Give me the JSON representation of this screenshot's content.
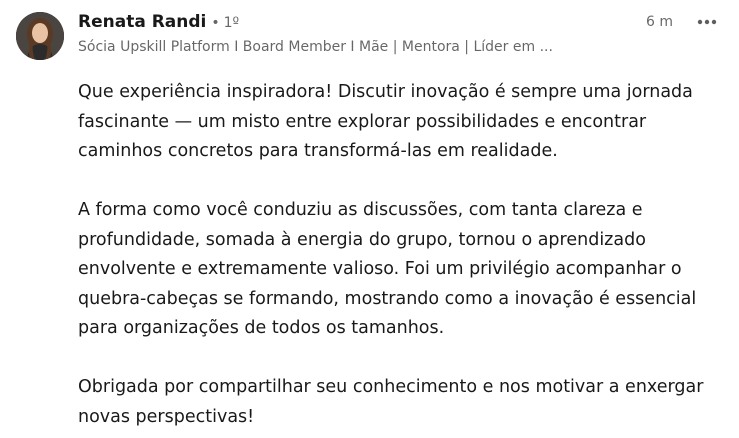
{
  "comment": {
    "author": {
      "name": "Renata Randi",
      "bullet": "•",
      "degree": "1º",
      "headline": "Sócia Upskill Platform I Board Member I Mãe | Mentora | Líder em ..."
    },
    "timestamp": "6 m",
    "more_icon": "more-horizontal-icon",
    "paragraphs": [
      "Que experiência inspiradora! Discutir inovação é sempre uma jornada fascinante — um misto entre explorar possibilidades e encontrar caminhos concretos para transformá-las em realidade.",
      "A forma como você conduziu as discussões, com tanta clareza e profundidade, somada à energia do grupo, tornou o aprendizado envolvente e extremamente valioso. Foi um privilégio acompanhar o quebra-cabeças se formando, mostrando como a inovação é essencial para organizações de todos os tamanhos.",
      "Obrigada por compartilhar seu conhecimento e nos motivar a enxergar novas perspectivas!"
    ]
  },
  "colors": {
    "text_primary": "#191919",
    "text_secondary": "#666666",
    "background": "#ffffff"
  }
}
